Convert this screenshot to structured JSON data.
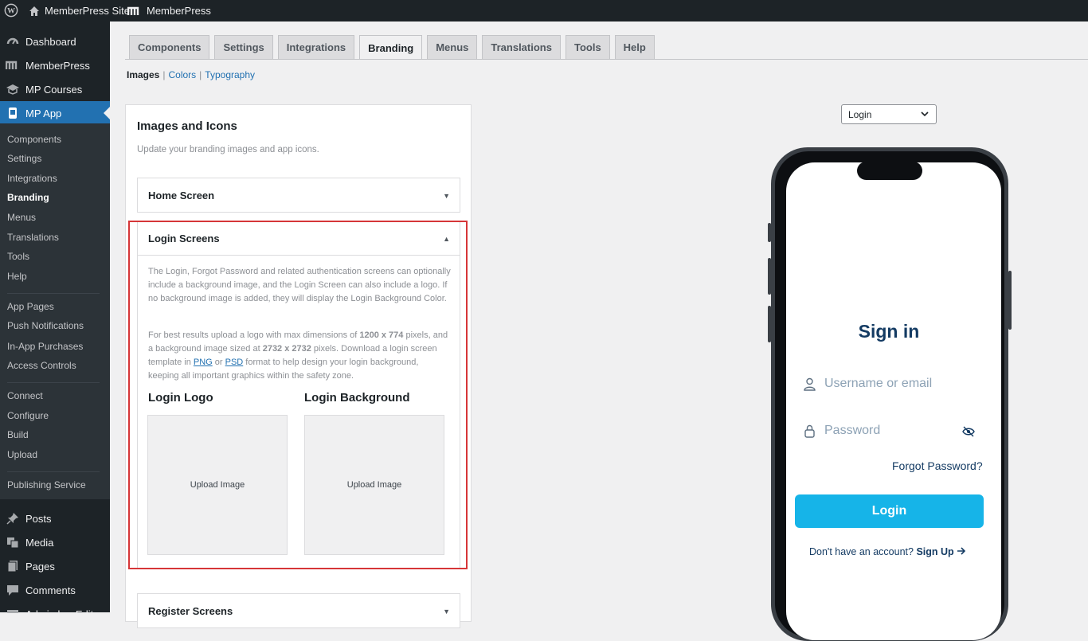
{
  "adminbar": {
    "site_name": "MemberPress Site",
    "plugin_name": "MemberPress"
  },
  "sidebar": {
    "top_items": [
      {
        "label": "Dashboard",
        "icon": "dashboard-icon"
      },
      {
        "label": "MemberPress",
        "icon": "memberpress-icon"
      },
      {
        "label": "MP Courses",
        "icon": "courses-icon"
      },
      {
        "label": "MP App",
        "icon": "app-icon"
      }
    ],
    "sub_items": [
      "Components",
      "Settings",
      "Integrations",
      "Branding",
      "Menus",
      "Translations",
      "Tools",
      "Help",
      "App Pages",
      "Push Notifications",
      "In-App Purchases",
      "Access Controls",
      "Connect",
      "Configure",
      "Build",
      "Upload",
      "Publishing Service"
    ],
    "active_sub": "Branding",
    "bottom_items": [
      {
        "label": "Posts",
        "icon": "pin-icon"
      },
      {
        "label": "Media",
        "icon": "media-icon"
      },
      {
        "label": "Pages",
        "icon": "pages-icon"
      },
      {
        "label": "Comments",
        "icon": "comments-icon"
      },
      {
        "label": "Admin bar Editor",
        "icon": "admin-bar-icon"
      }
    ]
  },
  "tabs": [
    "Components",
    "Settings",
    "Integrations",
    "Branding",
    "Menus",
    "Translations",
    "Tools",
    "Help"
  ],
  "active_tab": "Branding",
  "subnav": {
    "current": "Images",
    "links": [
      "Colors",
      "Typography"
    ]
  },
  "panel": {
    "title": "Images and Icons",
    "description": "Update your branding images and app icons.",
    "home_section": "Home Screen",
    "login_section": "Login Screens",
    "login_para1": "The Login, Forgot Password and related authentication screens can optionally include a background image, and the Login Screen can also include a logo. If no background image is added, they will display the Login Background Color.",
    "login_para2_a": "For best results upload a logo with max dimensions of ",
    "logo_dims": "1200 x 774",
    "login_para2_b": " pixels, and a background image sized at ",
    "bg_dims": "2732 x 2732",
    "login_para2_c": " pixels. Download a login screen template in ",
    "png_link": "PNG",
    "login_para2_d": " or ",
    "psd_link": "PSD",
    "login_para2_e": " format to help design your login background, keeping all important graphics within the safety zone.",
    "logo_label": "Login Logo",
    "background_label": "Login Background",
    "upload_label": "Upload Image",
    "register_section": "Register Screens"
  },
  "preview": {
    "selected_screen": "Login",
    "signin_title": "Sign in",
    "username_placeholder": "Username or email",
    "password_placeholder": "Password",
    "forgot_link": "Forgot Password?",
    "login_button": "Login",
    "signup_prompt": "Don't have an account?",
    "signup_link": "Sign Up",
    "accent_color": "#16b4e8",
    "heading_color": "#143b63"
  },
  "colors": {
    "highlight": "#d63638",
    "wp_blue": "#2271b1",
    "sidebar_bg": "#1d2327"
  }
}
